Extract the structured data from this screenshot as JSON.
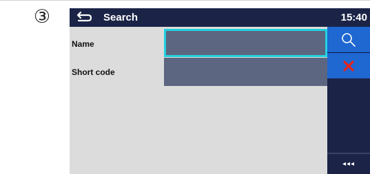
{
  "step_marker": "③",
  "header": {
    "title": "Search",
    "time": "15:40",
    "back_icon": "back-arrow-icon"
  },
  "form": {
    "name_label": "Name",
    "name_value": "",
    "short_code_label": "Short code",
    "short_code_value": ""
  },
  "sidebar": {
    "search_icon": "search-icon",
    "clear_icon": "close-icon",
    "more_label": "◂◂◂"
  },
  "colors": {
    "header_bg": "#1b2447",
    "field_bg": "#5d6680",
    "focus_border": "#21d2df",
    "button_bg": "#1f67d1",
    "clear_x": "#e8221b",
    "screen_bg": "#dcdcdc"
  }
}
